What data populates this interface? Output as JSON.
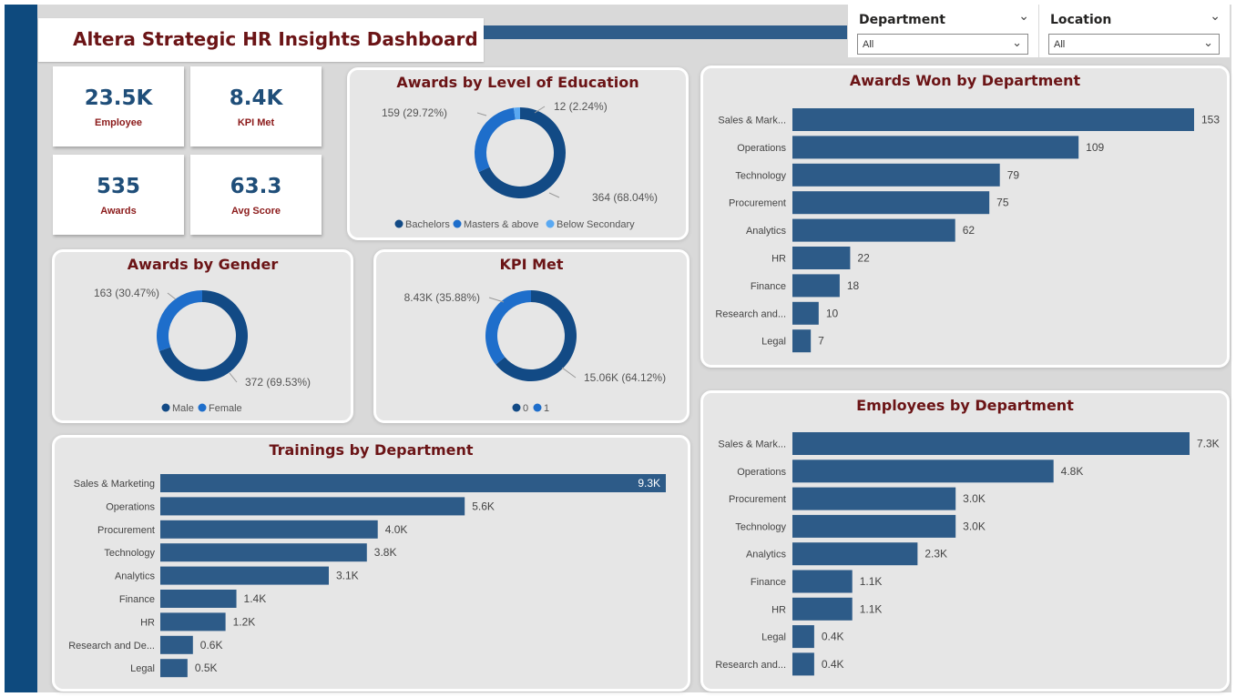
{
  "header": {
    "title": "Altera Strategic HR Insights Dashboard"
  },
  "filters": [
    {
      "label": "Department",
      "value": "All"
    },
    {
      "label": "Location",
      "value": "All"
    }
  ],
  "kpis": [
    {
      "value": "23.5K",
      "label": "Employee"
    },
    {
      "value": "8.4K",
      "label": "KPI Met"
    },
    {
      "value": "535",
      "label": "Awards"
    },
    {
      "value": "63.3",
      "label": "Avg Score"
    }
  ],
  "colors": {
    "dark": "#124a85",
    "mid": "#1e6ecb",
    "light": "#5aa9f2",
    "bar": "#2d5b88",
    "title": "#6b1416"
  },
  "chart_data": [
    {
      "id": "education",
      "type": "pie",
      "title": "Awards by Level of Education",
      "categories": [
        "Bachelors",
        "Masters & above",
        "Below Secondary"
      ],
      "values": [
        364,
        159,
        12
      ],
      "labels": [
        "364 (68.04%)",
        "159 (29.72%)",
        "12 (2.24%)"
      ],
      "legend": "bottom"
    },
    {
      "id": "gender",
      "type": "pie",
      "title": "Awards by Gender",
      "categories": [
        "Male",
        "Female"
      ],
      "values": [
        372,
        163
      ],
      "labels": [
        "372 (69.53%)",
        "163 (30.47%)"
      ],
      "legend": "bottom"
    },
    {
      "id": "kpimet",
      "type": "pie",
      "title": "KPI Met",
      "categories": [
        "0",
        "1"
      ],
      "values": [
        15060,
        8430
      ],
      "labels": [
        "15.06K (64.12%)",
        "8.43K (35.88%)"
      ],
      "legend": "bottom"
    },
    {
      "id": "awards_dept",
      "type": "bar",
      "title": "Awards Won by Department",
      "categories": [
        "Sales & Mark...",
        "Operations",
        "Technology",
        "Procurement",
        "Analytics",
        "HR",
        "Finance",
        "Research and...",
        "Legal"
      ],
      "values": [
        153,
        109,
        79,
        75,
        62,
        22,
        18,
        10,
        7
      ],
      "labels": [
        "153",
        "109",
        "79",
        "75",
        "62",
        "22",
        "18",
        "10",
        "7"
      ]
    },
    {
      "id": "employees_dept",
      "type": "bar",
      "title": "Employees by Department",
      "categories": [
        "Sales & Mark...",
        "Operations",
        "Procurement",
        "Technology",
        "Analytics",
        "Finance",
        "HR",
        "Legal",
        "Research and..."
      ],
      "values": [
        7300,
        4800,
        3000,
        3000,
        2300,
        1100,
        1100,
        400,
        400
      ],
      "labels": [
        "7.3K",
        "4.8K",
        "3.0K",
        "3.0K",
        "2.3K",
        "1.1K",
        "1.1K",
        "0.4K",
        "0.4K"
      ]
    },
    {
      "id": "trainings_dept",
      "type": "bar",
      "title": "Trainings by Department",
      "categories": [
        "Sales & Marketing",
        "Operations",
        "Procurement",
        "Technology",
        "Analytics",
        "Finance",
        "HR",
        "Research and De...",
        "Legal"
      ],
      "values": [
        9300,
        5600,
        4000,
        3800,
        3100,
        1400,
        1200,
        600,
        500
      ],
      "labels": [
        "9.3K",
        "5.6K",
        "4.0K",
        "3.8K",
        "3.1K",
        "1.4K",
        "1.2K",
        "0.6K",
        "0.5K"
      ]
    }
  ]
}
